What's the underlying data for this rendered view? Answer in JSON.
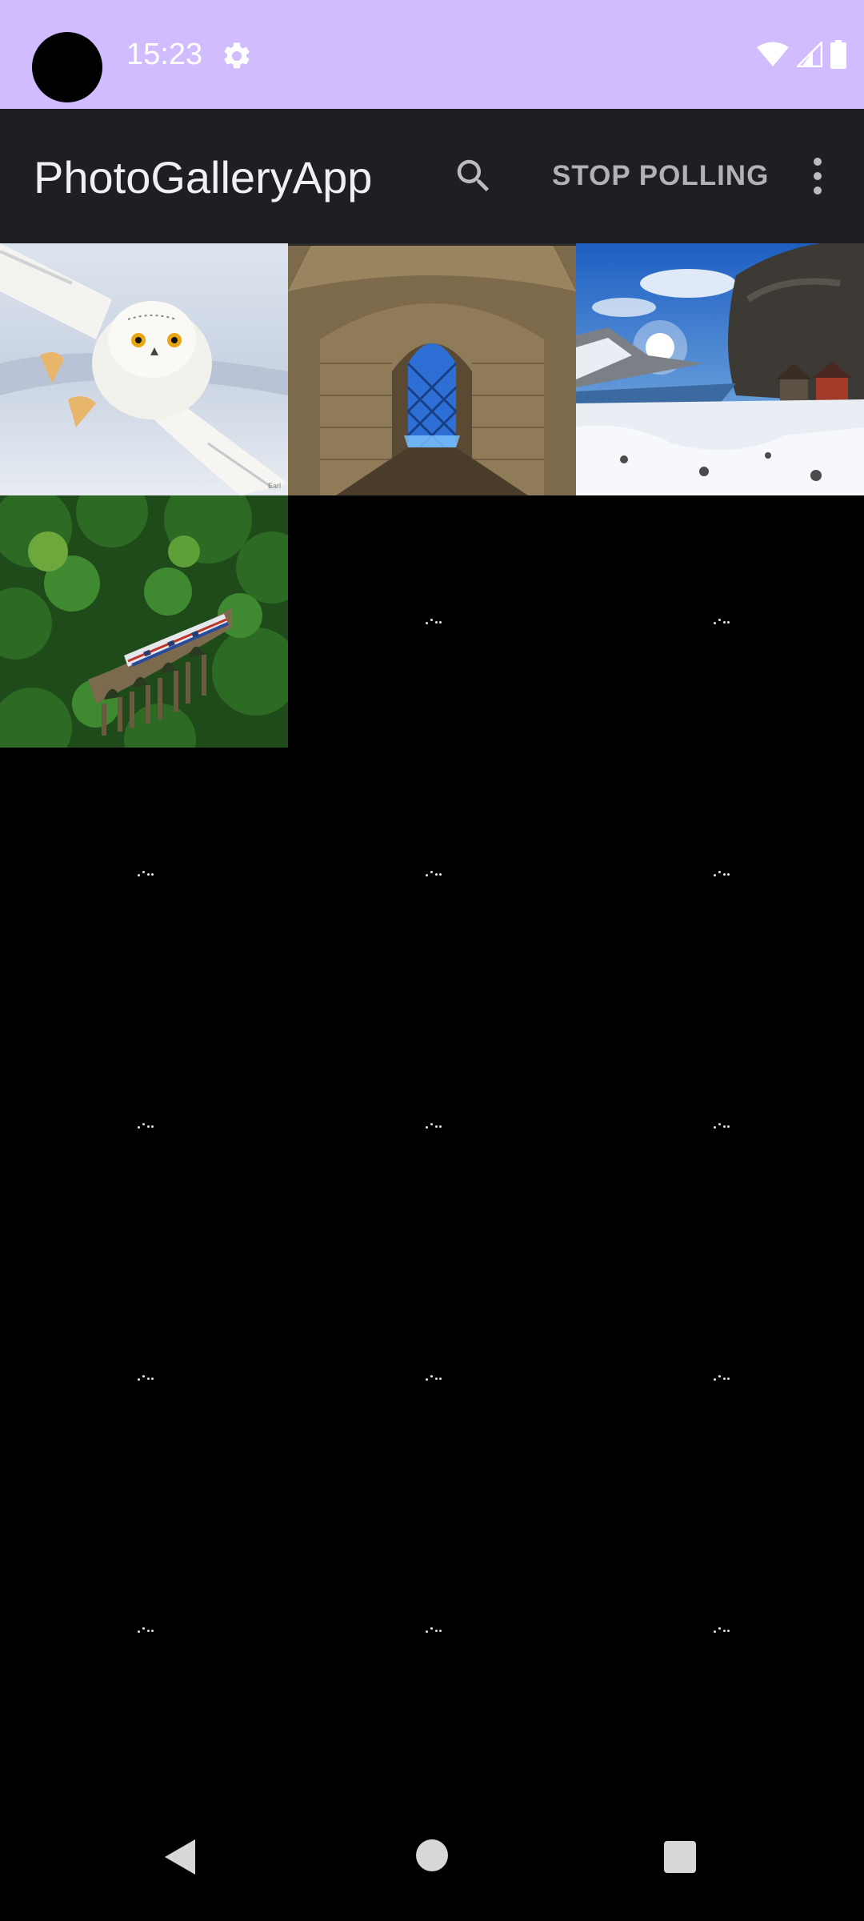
{
  "status_bar": {
    "time": "15:23",
    "background_color": "#d0bcff",
    "icons": [
      "settings-icon",
      "wifi-icon",
      "cellular-signal-icon",
      "battery-icon"
    ]
  },
  "app_bar": {
    "title": "PhotoGalleryApp",
    "search_icon": "search-icon",
    "stop_polling_label": "STOP POLLING",
    "overflow_icon": "more-vert-icon",
    "background_color": "#1f1e24"
  },
  "gallery": {
    "columns": 3,
    "photos": [
      {
        "subject": "snowy owl in flight",
        "loaded": true
      },
      {
        "subject": "stone archway with blue door",
        "loaded": true
      },
      {
        "subject": "snowy fjord with red cabins",
        "loaded": true
      },
      {
        "subject": "train on stone viaduct in forest",
        "loaded": true
      }
    ],
    "loading_placeholders": 14
  },
  "nav_bar": {
    "buttons": [
      "back-icon",
      "home-icon",
      "recents-icon"
    ]
  }
}
